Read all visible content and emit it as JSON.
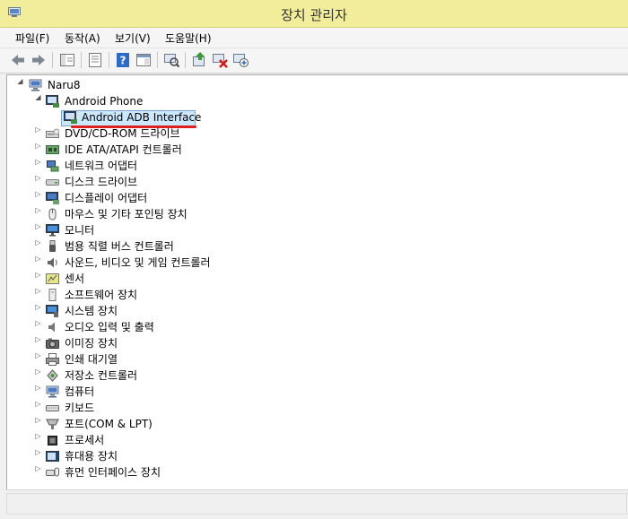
{
  "window": {
    "title": "장치 관리자"
  },
  "menu": [
    {
      "label": "파일(F)"
    },
    {
      "label": "동작(A)"
    },
    {
      "label": "보기(V)"
    },
    {
      "label": "도움말(H)"
    }
  ],
  "toolbar": {
    "buttons": [
      {
        "icon": "back-arrow-icon"
      },
      {
        "icon": "forward-arrow-icon"
      },
      {
        "icon": "show-hide-tree-icon"
      },
      {
        "icon": "properties-icon"
      },
      {
        "icon": "help-icon"
      },
      {
        "icon": "console-view-icon"
      },
      {
        "icon": "scan-hardware-icon"
      },
      {
        "icon": "update-driver-icon"
      },
      {
        "icon": "uninstall-device-icon"
      },
      {
        "icon": "add-legacy-hardware-icon"
      }
    ]
  },
  "tree": {
    "root": "Naru8",
    "expanded_category": "Android Phone",
    "selected_device": "Android ADB Interface",
    "categories": [
      "DVD/CD-ROM 드라이브",
      "IDE ATA/ATAPI 컨트롤러",
      "네트워크 어댑터",
      "디스크 드라이브",
      "디스플레이 어댑터",
      "마우스 및 기타 포인팅 장치",
      "모니터",
      "범용 직렬 버스 컨트롤러",
      "사운드, 비디오 및 게임 컨트롤러",
      "센서",
      "소프트웨어 장치",
      "시스템 장치",
      "오디오 입력 및 출력",
      "이미징 장치",
      "인쇄 대기열",
      "저장소 컨트롤러",
      "컴퓨터",
      "키보드",
      "포트(COM & LPT)",
      "프로세서",
      "휴대용 장치",
      "휴먼 인터페이스 장치"
    ],
    "category_icons": [
      "dvd-drive-icon",
      "ide-controller-icon",
      "network-adapter-icon",
      "disk-drive-icon",
      "display-adapter-icon",
      "mouse-icon",
      "monitor-icon",
      "usb-icon",
      "sound-icon",
      "sensor-icon",
      "software-device-icon",
      "system-device-icon",
      "audio-io-icon",
      "imaging-device-icon",
      "printer-icon",
      "storage-controller-icon",
      "computer-icon",
      "keyboard-icon",
      "port-icon",
      "processor-icon",
      "portable-device-icon",
      "hid-icon"
    ]
  },
  "colors": {
    "titlebar": "#f1ed9a",
    "selection": "#cce8ff",
    "annotation_underline": "#e02020"
  }
}
